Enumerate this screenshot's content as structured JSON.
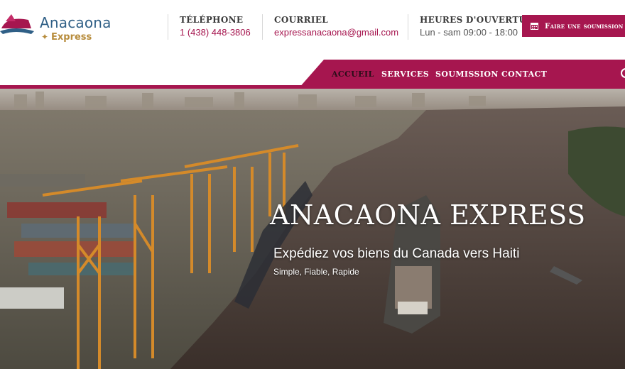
{
  "brand": {
    "name": "Anacaona",
    "sub": "Express",
    "colors": {
      "accent": "#a6164f",
      "logo_blue": "#2f5f86",
      "logo_gold": "#b78c3c"
    }
  },
  "header": {
    "phone": {
      "title": "TÉLÉPHONE",
      "value": "1 (438) 448-3806"
    },
    "email": {
      "title": "COURRIEL",
      "value": "expressanacaona@gmail.com"
    },
    "hours": {
      "title": "HEURES D'OUVERTURE",
      "value": "Lun - sam 09:00 - 18:00"
    },
    "quote_button": {
      "label": "Faire une soumission",
      "icon": "calendar-icon"
    }
  },
  "nav": {
    "items": [
      {
        "label": "ACCUEIL",
        "active": true
      },
      {
        "label": "SERVICES",
        "active": false
      },
      {
        "label": "SOUMISSION",
        "active": false
      },
      {
        "label": "CONTACT",
        "active": false
      }
    ],
    "search_icon": "search-icon"
  },
  "hero": {
    "title": "ANACAONA EXPRESS",
    "subtitle": "Expédiez vos biens du Canada vers Haiti",
    "tagline": "Simple, Fiable, Rapide"
  }
}
